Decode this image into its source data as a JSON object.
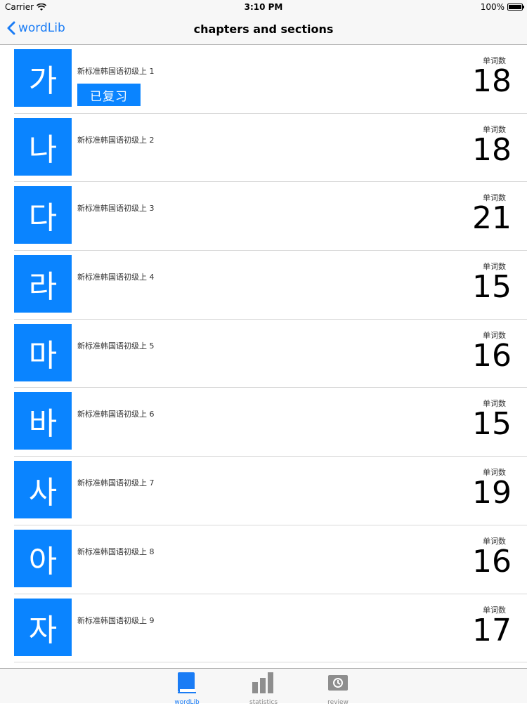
{
  "status_bar": {
    "carrier": "Carrier",
    "time": "3:10 PM",
    "battery": "100%"
  },
  "nav": {
    "back_label": "wordLib",
    "title": "chapters and sections"
  },
  "list": {
    "count_label": "单词数",
    "reviewed_label": "已复习",
    "rows": [
      {
        "letter": "가",
        "title": "新标准韩国语初级上 1",
        "count": "18",
        "reviewed": true
      },
      {
        "letter": "나",
        "title": "新标准韩国语初级上 2",
        "count": "18",
        "reviewed": false
      },
      {
        "letter": "다",
        "title": "新标准韩国语初级上 3",
        "count": "21",
        "reviewed": false
      },
      {
        "letter": "라",
        "title": "新标准韩国语初级上 4",
        "count": "15",
        "reviewed": false
      },
      {
        "letter": "마",
        "title": "新标准韩国语初级上 5",
        "count": "16",
        "reviewed": false
      },
      {
        "letter": "바",
        "title": "新标准韩国语初级上 6",
        "count": "15",
        "reviewed": false
      },
      {
        "letter": "사",
        "title": "新标准韩国语初级上 7",
        "count": "19",
        "reviewed": false
      },
      {
        "letter": "아",
        "title": "新标准韩国语初级上 8",
        "count": "16",
        "reviewed": false
      },
      {
        "letter": "자",
        "title": "新标准韩国语初级上 9",
        "count": "17",
        "reviewed": false
      }
    ]
  },
  "tab_bar": {
    "items": [
      {
        "label": "wordLib",
        "icon": "book-icon",
        "active": true
      },
      {
        "label": "statistics",
        "icon": "bar-chart-icon",
        "active": false
      },
      {
        "label": "review",
        "icon": "review-icon",
        "active": false
      }
    ]
  },
  "colors": {
    "accent": "#1a7cf5",
    "tile": "#0a84ff"
  }
}
